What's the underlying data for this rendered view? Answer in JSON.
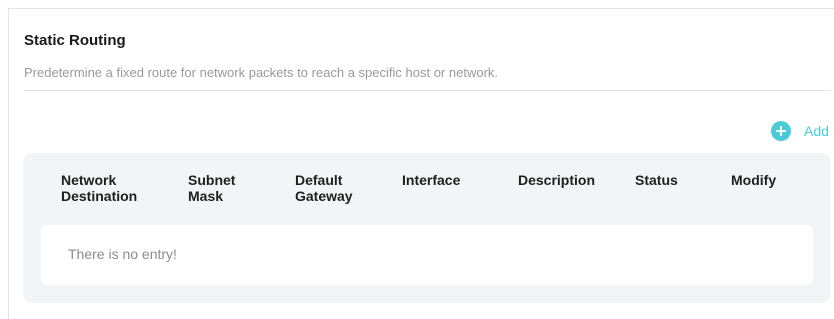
{
  "section": {
    "title": "Static Routing",
    "description": "Predetermine a fixed route for network packets to reach a specific host or network."
  },
  "toolbar": {
    "add_label": "Add",
    "add_icon": "plus-circle-icon"
  },
  "table": {
    "columns": [
      {
        "line1": "Network",
        "line2": "Destination"
      },
      {
        "line1": "Subnet",
        "line2": "Mask"
      },
      {
        "line1": "Default",
        "line2": "Gateway"
      },
      {
        "line1": "Interface",
        "line2": ""
      },
      {
        "line1": "Description",
        "line2": ""
      },
      {
        "line1": "Status",
        "line2": ""
      },
      {
        "line1": "Modify",
        "line2": ""
      }
    ],
    "rows": [],
    "empty_message": "There is no entry!"
  },
  "colors": {
    "accent": "#4acbd6",
    "table_bg": "#f2f4f8",
    "muted_text": "#9a9a9a"
  }
}
